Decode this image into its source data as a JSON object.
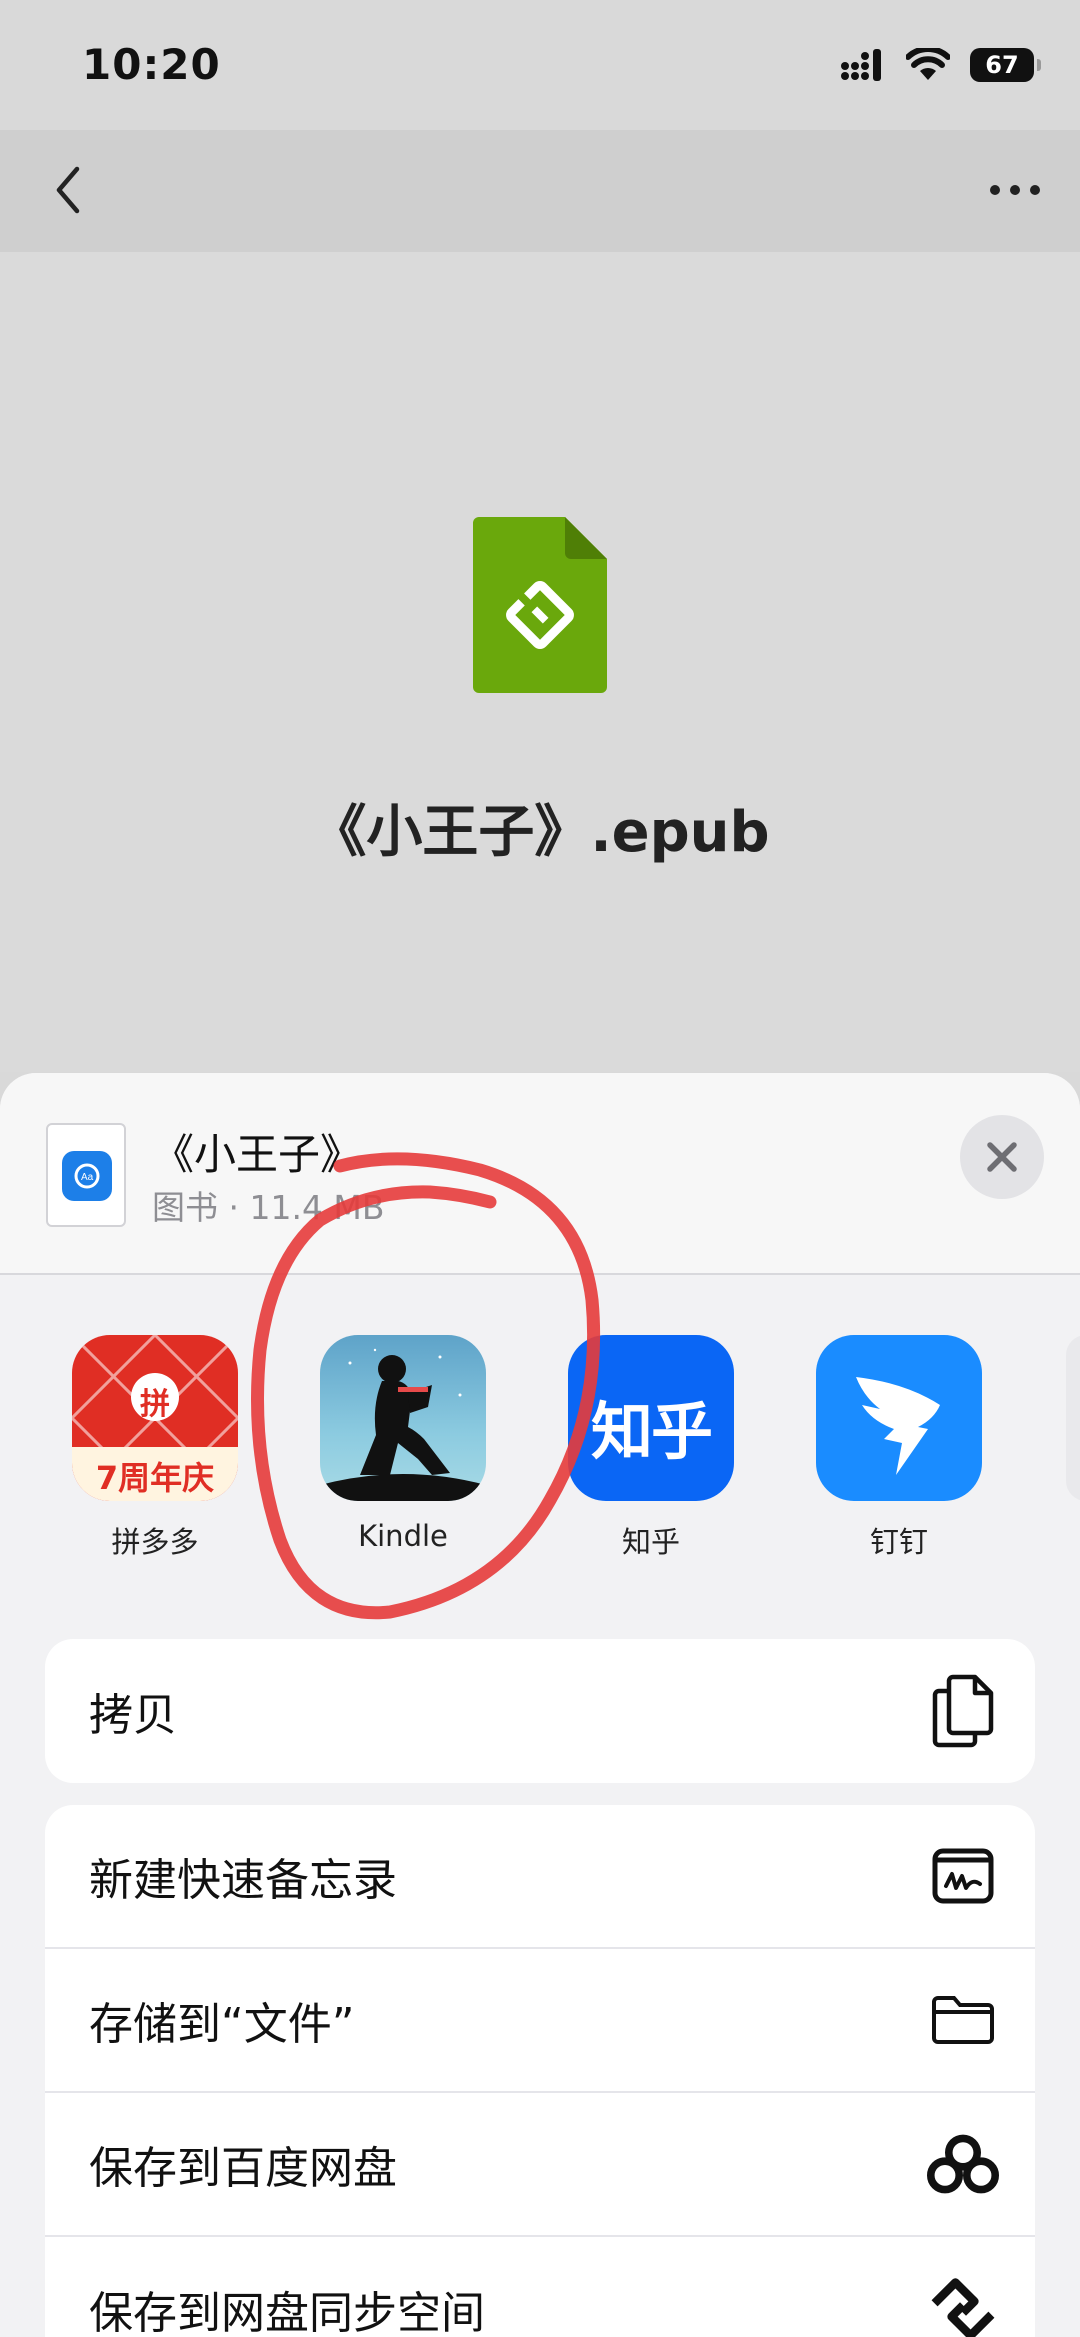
{
  "status_bar": {
    "time": "10:20",
    "battery": "67"
  },
  "preview": {
    "file_name": "《小王子》.epub"
  },
  "share_sheet": {
    "title": "《小王子》",
    "subtitle": "图书 · 11.4 MB",
    "apps": [
      {
        "label": "拼多多",
        "icon_text": "拼",
        "icon_banner": "7周年庆"
      },
      {
        "label": "Kindle"
      },
      {
        "label": "知乎",
        "icon_text": "知乎"
      },
      {
        "label": "钉钉"
      }
    ],
    "actions_1": [
      {
        "label": "拷贝",
        "icon": "copy-icon"
      }
    ],
    "actions_2": [
      {
        "label": "新建快速备忘录",
        "icon": "quick-note-icon"
      },
      {
        "label": "存储到“文件”",
        "icon": "folder-icon"
      },
      {
        "label": "保存到百度网盘",
        "icon": "baidu-netdisk-icon"
      },
      {
        "label": "保存到网盘同步空间",
        "icon": "sync-space-icon"
      }
    ]
  },
  "colors": {
    "epub_green": "#6aa80c",
    "annotation_red": "#e63b3b",
    "zhihu_blue": "#0a66f5",
    "dingtalk_blue": "#1a8cff"
  }
}
